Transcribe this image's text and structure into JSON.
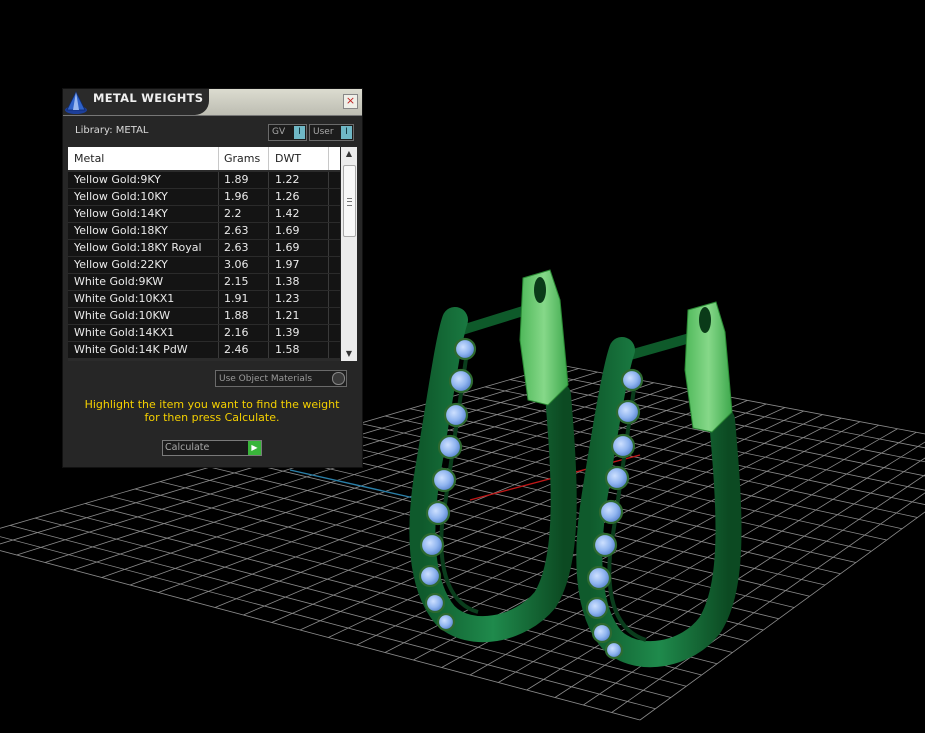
{
  "panel": {
    "title": "METAL WEIGHTS",
    "close_glyph": "×",
    "library_label": "Library: METAL",
    "toggles": {
      "gv_label": "GV",
      "user_label": "User",
      "indicator_glyph": "I"
    },
    "table": {
      "columns": [
        "Metal",
        "Grams",
        "DWT"
      ],
      "rows": [
        {
          "metal": "Yellow Gold:9KY",
          "grams": "1.89",
          "dwt": "1.22"
        },
        {
          "metal": "Yellow Gold:10KY",
          "grams": "1.96",
          "dwt": "1.26"
        },
        {
          "metal": "Yellow Gold:14KY",
          "grams": "2.2",
          "dwt": "1.42"
        },
        {
          "metal": "Yellow Gold:18KY",
          "grams": "2.63",
          "dwt": "1.69"
        },
        {
          "metal": "Yellow Gold:18KY Royal",
          "grams": "2.63",
          "dwt": "1.69"
        },
        {
          "metal": "Yellow Gold:22KY",
          "grams": "3.06",
          "dwt": "1.97"
        },
        {
          "metal": "White Gold:9KW",
          "grams": "2.15",
          "dwt": "1.38"
        },
        {
          "metal": "White Gold:10KX1",
          "grams": "1.91",
          "dwt": "1.23"
        },
        {
          "metal": "White Gold:10KW",
          "grams": "1.88",
          "dwt": "1.21"
        },
        {
          "metal": "White Gold:14KX1",
          "grams": "2.16",
          "dwt": "1.39"
        },
        {
          "metal": "White Gold:14K PdW",
          "grams": "2.46",
          "dwt": "1.58"
        }
      ]
    },
    "use_object_materials_label": "Use Object Materials",
    "hint_text": "Highlight the item you want to find the weight for then press Calculate.",
    "calculate_label": "Calculate"
  },
  "colors": {
    "hint": "#f4d000",
    "metal_green": "#1f8a4c",
    "gem_blue": "#8fb4ef",
    "toggle_indicator": "#6fb8c6",
    "calculate_go": "#39b53a"
  },
  "icons": {
    "app_logo": "cone-logo-icon",
    "close": "close-icon",
    "scroll_up": "scroll-up-arrow-icon",
    "scroll_down": "scroll-down-arrow-icon",
    "calculate_go": "play-arrow-icon"
  }
}
